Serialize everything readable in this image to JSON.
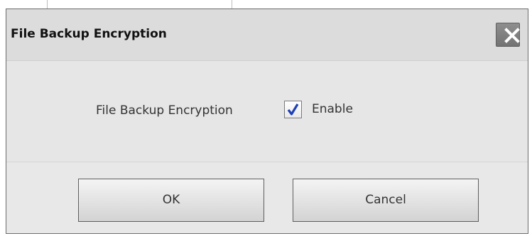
{
  "dialog": {
    "title": "File Backup Encryption",
    "close_icon": "close-icon",
    "field_label": "File Backup Encryption",
    "checkbox": {
      "label": "Enable",
      "checked": true,
      "check_icon": "checkmark-icon"
    },
    "buttons": {
      "ok_label": "OK",
      "cancel_label": "Cancel"
    }
  },
  "colors": {
    "title_bar": "#dcdcdc",
    "dialog_body": "#e6e6e6",
    "close_button": "#7a7a7a",
    "checkmark": "#1f3fb5"
  }
}
